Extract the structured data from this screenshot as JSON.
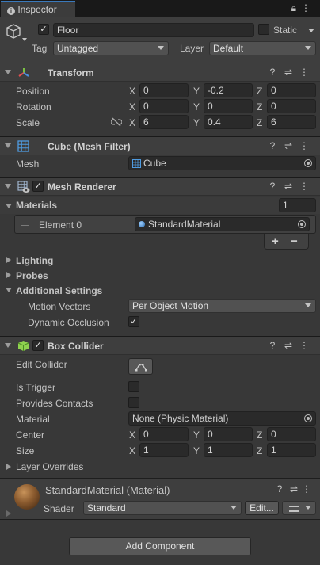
{
  "tab": {
    "label": "Inspector"
  },
  "header": {
    "name": "Floor",
    "active": true,
    "static_label": "Static",
    "tag_label": "Tag",
    "tag_value": "Untagged",
    "layer_label": "Layer",
    "layer_value": "Default"
  },
  "transform": {
    "title": "Transform",
    "position": {
      "label": "Position",
      "x": "0",
      "y": "-0.2",
      "z": "0"
    },
    "rotation": {
      "label": "Rotation",
      "x": "0",
      "y": "0",
      "z": "0"
    },
    "scale": {
      "label": "Scale",
      "x": "6",
      "y": "0.4",
      "z": "6"
    }
  },
  "mesh_filter": {
    "title": "Cube (Mesh Filter)",
    "mesh_label": "Mesh",
    "mesh_value": "Cube"
  },
  "mesh_renderer": {
    "title": "Mesh Renderer",
    "materials_label": "Materials",
    "materials_count": "1",
    "element_label": "Element 0",
    "element_value": "StandardMaterial",
    "add": "+",
    "remove": "−",
    "lighting": "Lighting",
    "probes": "Probes",
    "additional": "Additional Settings",
    "motion_label": "Motion Vectors",
    "motion_value": "Per Object Motion",
    "occlusion_label": "Dynamic Occlusion"
  },
  "box_collider": {
    "title": "Box Collider",
    "edit_label": "Edit Collider",
    "trigger_label": "Is Trigger",
    "contacts_label": "Provides Contacts",
    "material_label": "Material",
    "material_value": "None (Physic Material)",
    "center": {
      "label": "Center",
      "x": "0",
      "y": "0",
      "z": "0"
    },
    "size": {
      "label": "Size",
      "x": "1",
      "y": "1",
      "z": "1"
    },
    "layer_overrides": "Layer Overrides"
  },
  "material": {
    "title": "StandardMaterial (Material)",
    "shader_label": "Shader",
    "shader_value": "Standard",
    "edit_button": "Edit..."
  },
  "add_component": "Add Component",
  "axes": {
    "x": "X",
    "y": "Y",
    "z": "Z"
  }
}
